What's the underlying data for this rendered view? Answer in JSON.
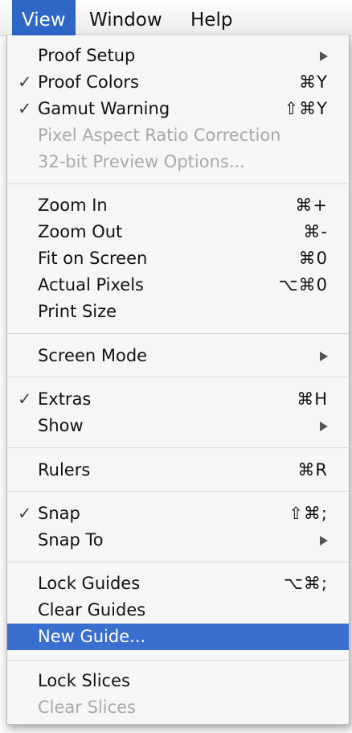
{
  "menubar": {
    "view": "View",
    "window": "Window",
    "help": "Help"
  },
  "menu": {
    "proof_setup": "Proof Setup",
    "proof_colors": "Proof Colors",
    "proof_colors_sc": "⌘Y",
    "gamut_warning": "Gamut Warning",
    "gamut_warning_sc": "⇧⌘Y",
    "pixel_aspect": "Pixel Aspect Ratio Correction",
    "preview_32bit": "32-bit Preview Options...",
    "zoom_in": "Zoom In",
    "zoom_in_sc": "⌘+",
    "zoom_out": "Zoom Out",
    "zoom_out_sc": "⌘-",
    "fit_on_screen": "Fit on Screen",
    "fit_on_screen_sc": "⌘0",
    "actual_pixels": "Actual Pixels",
    "actual_pixels_sc": "⌥⌘0",
    "print_size": "Print Size",
    "screen_mode": "Screen Mode",
    "extras": "Extras",
    "extras_sc": "⌘H",
    "show": "Show",
    "rulers": "Rulers",
    "rulers_sc": "⌘R",
    "snap": "Snap",
    "snap_sc": "⇧⌘;",
    "snap_to": "Snap To",
    "lock_guides": "Lock Guides",
    "lock_guides_sc": "⌥⌘;",
    "clear_guides": "Clear Guides",
    "new_guide": "New Guide...",
    "lock_slices": "Lock Slices",
    "clear_slices": "Clear Slices",
    "check_mark": "✓"
  }
}
